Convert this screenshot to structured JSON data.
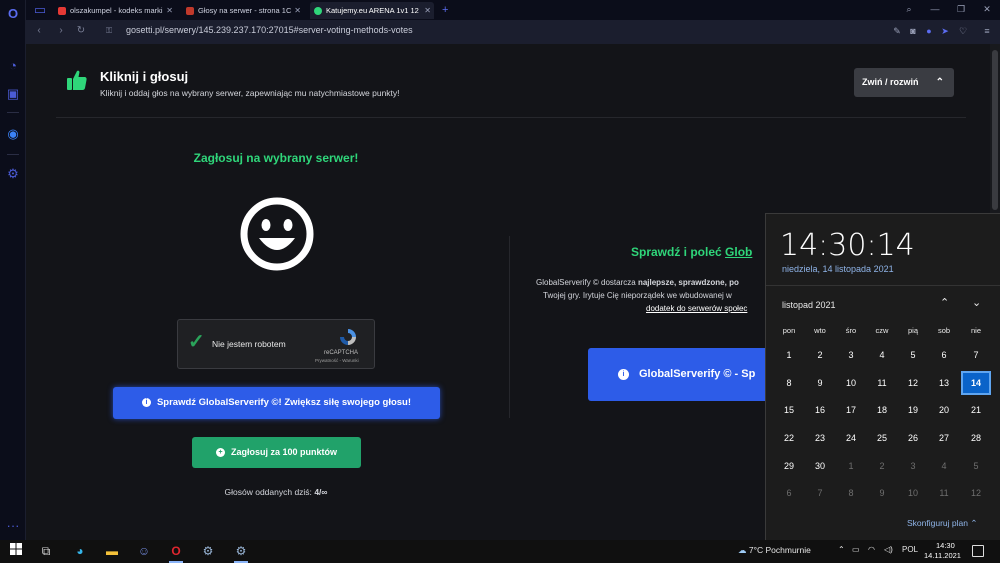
{
  "browser": {
    "tabs": [
      {
        "title": "olszakumpel - kodeks marki",
        "fav_color": "#e53935"
      },
      {
        "title": "Głosy na serwer - strona 1C",
        "fav_color": "#c0392b"
      },
      {
        "title": "Katujemy.eu ARENA 1v1 12",
        "fav_color": "#2fd67a"
      }
    ],
    "url": "gosetti.pl/serwery/145.239.237.170:27015#server-voting-methods-votes",
    "nav": {
      "back": "‹",
      "forward": "›",
      "reload": "↻",
      "lock": "🔒",
      "new_tab": "+"
    }
  },
  "header": {
    "title": "Kliknij i głosuj",
    "subtitle": "Kliknij i oddaj głos na wybrany serwer, zapewniając mu natychmiastowe punkty!",
    "toggle_label": "Zwiń / rozwiń",
    "toggle_icon": "chevron-up-icon"
  },
  "vote": {
    "heading": "Zagłosuj na wybrany serwer!",
    "recaptcha_label": "Nie jestem robotem",
    "recaptcha_brand": "reCAPTCHA",
    "recaptcha_links": "Prywatność - Warunki",
    "gs_button": "Sprawdź GlobalServerify ©! Zwiększ siłę swojego głosu!",
    "vote_button": "Zagłosuj za 100 punktów",
    "votes_today_label": "Głosów oddanych dziś:",
    "votes_today_value": "4/∞"
  },
  "right": {
    "heading_prefix": "Sprawdź i poleć ",
    "heading_link": "Glob",
    "desc_line1_pre": "GlobalServerify © dostarcza ",
    "desc_line1_bold": "najlepsze, sprawdzone, po",
    "desc_line2": "Twojej gry. Irytuje Cię nieporządek we wbudowanej w",
    "desc_line3": "dodatek do serwerów społec",
    "button": "GlobalServerify © - Sp"
  },
  "clock_flyout": {
    "time": "14:30:14",
    "date": "niedziela, 14 listopada 2021",
    "month": "listopad 2021",
    "weekdays": [
      "pon",
      "wto",
      "śro",
      "czw",
      "pią",
      "sob",
      "nie"
    ],
    "weeks": [
      [
        "1",
        "2",
        "3",
        "4",
        "5",
        "6",
        "7"
      ],
      [
        "8",
        "9",
        "10",
        "11",
        "12",
        "13",
        "14"
      ],
      [
        "15",
        "16",
        "17",
        "18",
        "19",
        "20",
        "21"
      ],
      [
        "22",
        "23",
        "24",
        "25",
        "26",
        "27",
        "28"
      ],
      [
        "29",
        "30",
        "1",
        "2",
        "3",
        "4",
        "5"
      ],
      [
        "6",
        "7",
        "8",
        "9",
        "10",
        "11",
        "12"
      ]
    ],
    "today": "14",
    "configure_label": "Skonfiguruj plan"
  },
  "taskbar": {
    "weather": "7°C  Pochmurnie",
    "lang": "POL",
    "time": "14:30",
    "date": "14.11.2021"
  },
  "colors": {
    "accent_green": "#2fd67a",
    "button_blue": "#2d5ce8",
    "vote_green": "#21a26a",
    "today_blue": "#0a63c9"
  }
}
